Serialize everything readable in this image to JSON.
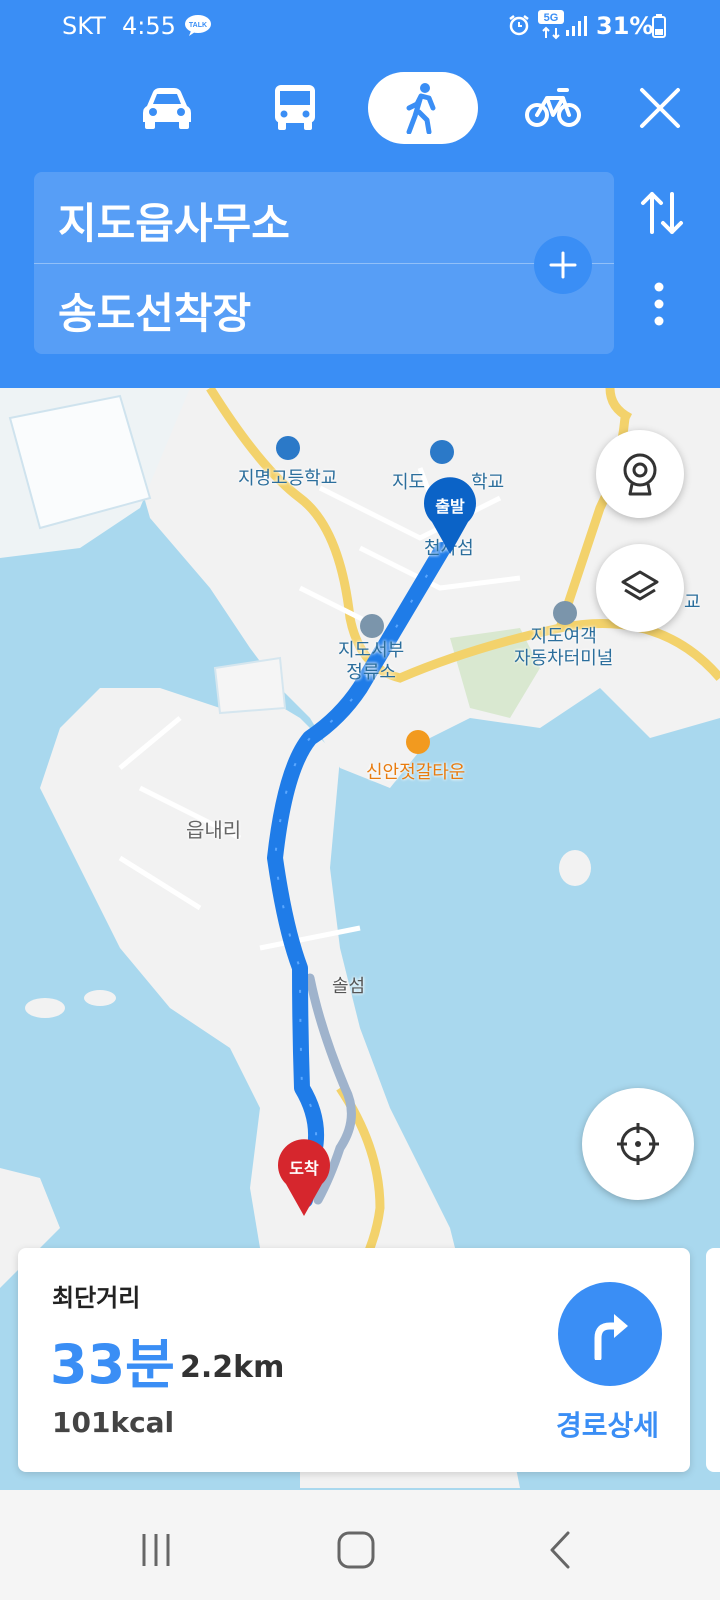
{
  "status_bar": {
    "carrier": "SKT",
    "time": "4:55",
    "network": "5G",
    "battery": "31%",
    "icons": [
      "talk-icon",
      "alarm-icon",
      "5g-network-icon",
      "signal-icon",
      "battery-icon"
    ]
  },
  "transport_modes": [
    {
      "name": "car",
      "icon": "car-icon",
      "selected": false
    },
    {
      "name": "bus",
      "icon": "bus-icon",
      "selected": false
    },
    {
      "name": "walk",
      "icon": "walk-icon",
      "selected": true
    },
    {
      "name": "bike",
      "icon": "bike-icon",
      "selected": false
    }
  ],
  "route": {
    "origin": "지도읍사무소",
    "destination": "송도선착장"
  },
  "map": {
    "labels": {
      "school1": "지명고등학교",
      "school2": "지도",
      "school2_tail": "학교",
      "start_badge": "출발",
      "cheonsa": "천사섬",
      "stop1a": "지도서부",
      "stop1b": "정류소",
      "terminal_a": "지도여객",
      "terminal_b": "자동차터미널",
      "market": "신안젓갈타운",
      "village": "읍내리",
      "island": "솔섬",
      "end_badge": "도착",
      "edge_school": "교"
    },
    "buttons": [
      "cctv-icon",
      "layers-icon",
      "current-location-icon"
    ]
  },
  "route_card": {
    "type": "최단거리",
    "duration": "33분",
    "distance": "2.2km",
    "calories": "101kcal",
    "details_label": "경로상세"
  },
  "colors": {
    "header": "#3a8ef5",
    "route_line": "#1f7ce8",
    "start_pin": "#0b63c7",
    "end_pin": "#d6262d",
    "water": "#a9d8ee",
    "land": "#f2f2f2",
    "road": "#f3d26b"
  }
}
